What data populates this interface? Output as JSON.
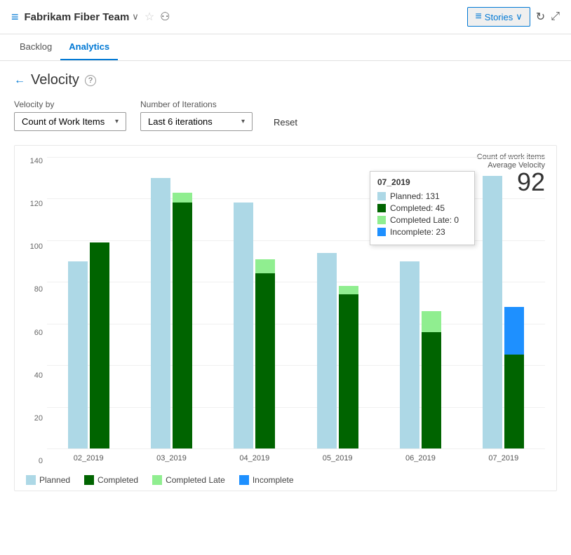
{
  "header": {
    "icon": "≡",
    "team_name": "Fabrikam Fiber Team",
    "chevron": "∨",
    "star": "☆",
    "team_icon": "⚇",
    "stories_label": "Stories",
    "stories_chevron": "∨",
    "refresh_label": "↻",
    "expand_label": "⤢"
  },
  "nav": {
    "tabs": [
      {
        "id": "backlog",
        "label": "Backlog",
        "active": false
      },
      {
        "id": "analytics",
        "label": "Analytics",
        "active": true
      }
    ]
  },
  "page": {
    "back_label": "←",
    "title": "Velocity",
    "help_label": "?"
  },
  "controls": {
    "velocity_by_label": "Velocity by",
    "velocity_by_value": "Count of Work Items",
    "iterations_label": "Number of Iterations",
    "iterations_value": "Last 6 iterations",
    "reset_label": "Reset"
  },
  "chart": {
    "summary_label1": "Count of work items",
    "summary_label2": "Average Velocity",
    "summary_value": "92",
    "y_labels": [
      "0",
      "20",
      "40",
      "60",
      "80",
      "100",
      "120",
      "140"
    ],
    "bar_groups": [
      {
        "label": "02_2019",
        "planned": 90,
        "completed": 99,
        "completed_late": 0,
        "incomplete": 0
      },
      {
        "label": "03_2019",
        "planned": 130,
        "completed": 118,
        "completed_late": 5,
        "incomplete": 0
      },
      {
        "label": "04_2019",
        "planned": 118,
        "completed": 84,
        "completed_late": 7,
        "incomplete": 0
      },
      {
        "label": "05_2019",
        "planned": 94,
        "completed": 74,
        "completed_late": 4,
        "incomplete": 0
      },
      {
        "label": "06_2019",
        "planned": 90,
        "completed": 56,
        "completed_late": 10,
        "incomplete": 0
      },
      {
        "label": "07_2019",
        "planned": 131,
        "completed": 45,
        "completed_late": 0,
        "incomplete": 23
      }
    ],
    "tooltip": {
      "title": "07_2019",
      "rows": [
        {
          "color": "#add8e6",
          "label": "Planned: 131"
        },
        {
          "color": "#006400",
          "label": "Completed: 45"
        },
        {
          "color": "#90ee90",
          "label": "Completed Late: 0"
        },
        {
          "color": "#1e90ff",
          "label": "Incomplete: 23"
        }
      ]
    },
    "legend": [
      {
        "color": "#add8e6",
        "label": "Planned"
      },
      {
        "color": "#006400",
        "label": "Completed"
      },
      {
        "color": "#90ee90",
        "label": "Completed Late"
      },
      {
        "color": "#1e90ff",
        "label": "Incomplete"
      }
    ]
  }
}
